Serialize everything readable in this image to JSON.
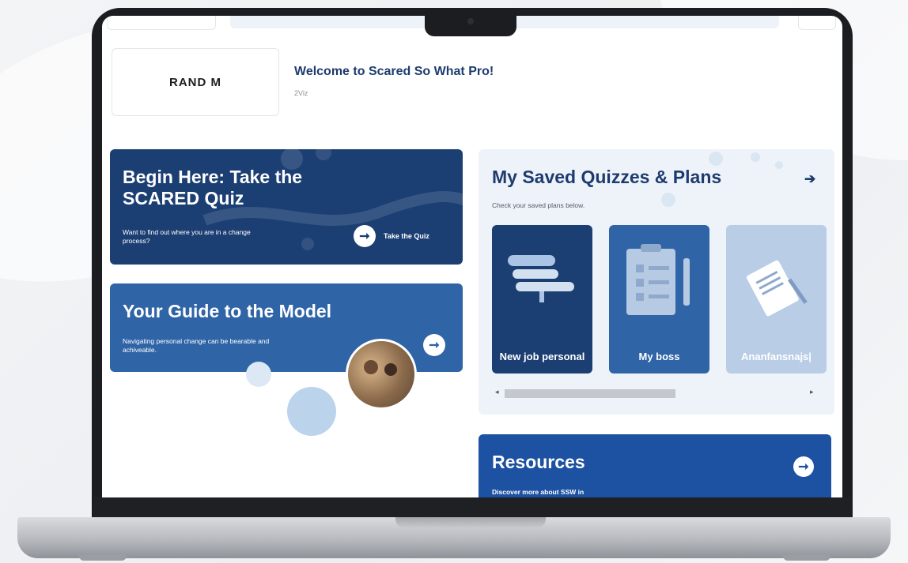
{
  "header": {
    "logo_text": "RAND  M",
    "welcome_title": "Welcome to Scared So What Pro!",
    "welcome_sub": "2Viz"
  },
  "begin_card": {
    "title": "Begin Here: Take the SCARED Quiz",
    "description": "Want to find out where you are in a change process?",
    "button_label": "Take the Quiz",
    "arrow_icon": "arrow-right-icon"
  },
  "guide_card": {
    "title": "Your Guide to the Model",
    "description": "Navigating personal change can be bearable and achiveable.",
    "arrow_icon": "arrow-right-icon"
  },
  "saved": {
    "title": "My Saved Quizzes & Plans",
    "subtitle": "Check your saved plans below.",
    "arrow_icon": "arrow-right-icon",
    "tiles": [
      {
        "label": "New job personal",
        "icon": "signpost-icon",
        "color": "#1c3f73"
      },
      {
        "label": "My boss",
        "icon": "checklist-clipboard-icon",
        "color": "#2f64a7"
      },
      {
        "label": "Ananfansnajs|",
        "icon": "document-pencil-icon",
        "color": "#b9cde6"
      }
    ],
    "scrollbar": {
      "left_arrow": "◂",
      "right_arrow": "▸"
    }
  },
  "resources": {
    "title": "Resources",
    "description": "Discover more about SSW in",
    "arrow_icon": "arrow-right-icon"
  },
  "colors": {
    "navy": "#1c3f73",
    "blue": "#2f64a7",
    "resources_blue": "#1d51a1",
    "panel_bg": "#eef3fa",
    "heading": "#1d3b6e"
  }
}
